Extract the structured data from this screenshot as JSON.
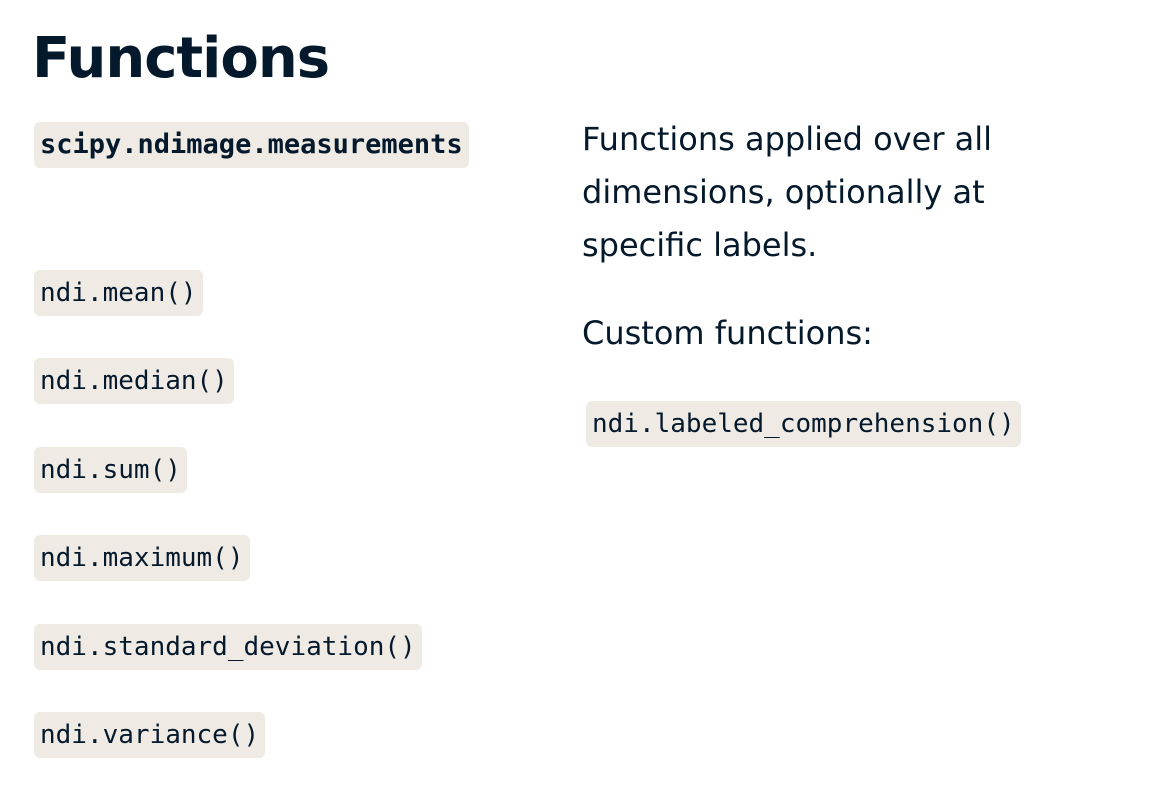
{
  "slide": {
    "title": "Functions"
  },
  "left_column": {
    "module_name": "scipy.ndimage.measurements",
    "functions": [
      "ndi.mean()",
      "ndi.median()",
      "ndi.sum()",
      "ndi.maximum()",
      "ndi.standard_deviation()",
      "ndi.variance()"
    ]
  },
  "right_column": {
    "description_line1": "Functions applied over all",
    "description_line2": "dimensions, optionally at",
    "description_line3": "specific labels.",
    "custom_heading": "Custom functions:",
    "custom_function": "ndi.labeled_comprehension()"
  }
}
